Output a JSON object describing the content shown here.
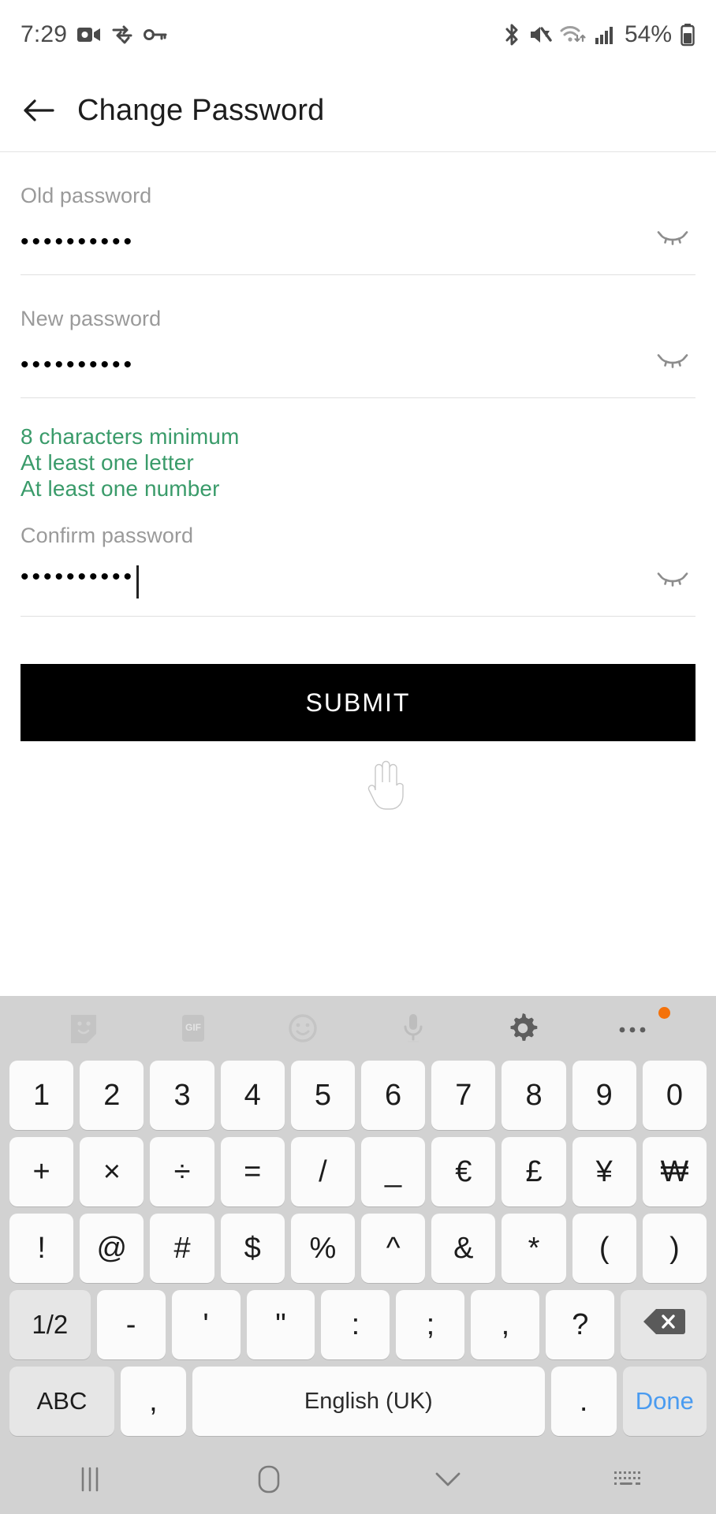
{
  "status_bar": {
    "time": "7:29",
    "battery_percent": "54%",
    "icons_left": [
      "video-camera-icon",
      "vpn-sync-icon",
      "key-icon"
    ],
    "icons_right": [
      "bluetooth-icon",
      "volume-mute-icon",
      "wifi-icon",
      "cellular-signal-icon"
    ]
  },
  "app_bar": {
    "back_icon": "back-arrow-icon",
    "title": "Change Password"
  },
  "form": {
    "old_password": {
      "label": "Old password",
      "value": "••••••••••",
      "reveal_icon": "eye-closed-icon"
    },
    "new_password": {
      "label": "New password",
      "value": "••••••••••",
      "reveal_icon": "eye-closed-icon"
    },
    "rules": [
      "8 characters minimum",
      "At least one letter",
      "At least one number"
    ],
    "rules_color": "#3a9b6a",
    "confirm_password": {
      "label": "Confirm password",
      "value": "••••••••••",
      "reveal_icon": "eye-closed-icon",
      "focused": true
    },
    "submit_label": "SUBMIT",
    "submit_bg": "#000000",
    "submit_fg": "#ffffff"
  },
  "keyboard": {
    "toolbar": [
      "sticker-icon",
      "gif-icon",
      "emoji-icon",
      "microphone-icon",
      "settings-gear-icon",
      "more-options-icon"
    ],
    "gif_label": "GIF",
    "badge_color": "#f4720b",
    "rows": [
      [
        "1",
        "2",
        "3",
        "4",
        "5",
        "6",
        "7",
        "8",
        "9",
        "0"
      ],
      [
        "+",
        "×",
        "÷",
        "=",
        "/",
        "_",
        "€",
        "£",
        "¥",
        "₩"
      ],
      [
        "!",
        "@",
        "#",
        "$",
        "%",
        "^",
        "&",
        "*",
        "(",
        ")"
      ]
    ],
    "row4": {
      "page_toggle": "1/2",
      "keys": [
        "-",
        "'",
        "\"",
        ":",
        ";",
        ",",
        "?"
      ],
      "backspace_icon": "backspace-icon"
    },
    "row5": {
      "abc": "ABC",
      "comma": ",",
      "space": "English (UK)",
      "period": ".",
      "done": "Done",
      "done_color": "#4a9bf0"
    },
    "background": "#d2d2d2",
    "key_background": "#fbfbfb"
  },
  "nav_bar": {
    "recents_icon": "recents-icon",
    "home_icon": "home-icon",
    "hide-keyboard_icon": "chevron-down-icon",
    "keyboard_switch_icon": "keyboard-switch-icon"
  }
}
